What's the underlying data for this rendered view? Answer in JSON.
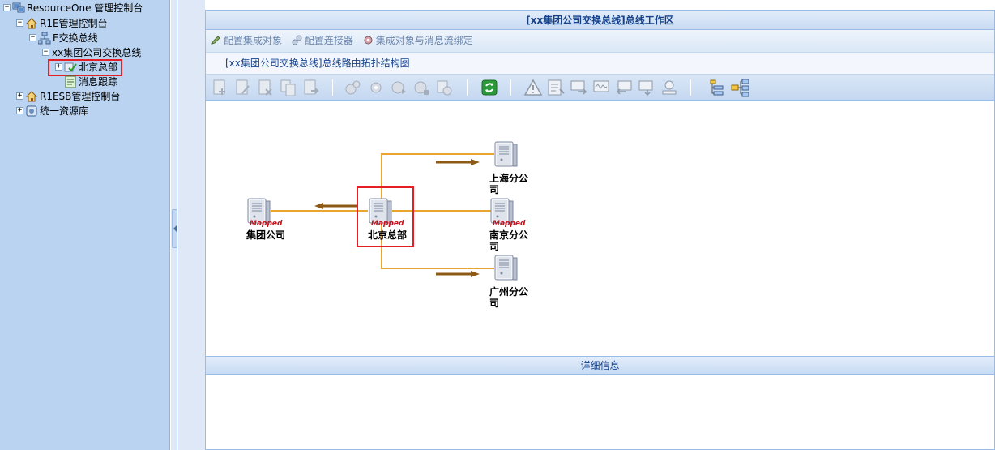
{
  "sidebar": {
    "items": [
      {
        "label": "ResourceOne 管理控制台",
        "icon": "network-computer-icon"
      },
      {
        "label": "R1E管理控制台",
        "icon": "home-icon"
      },
      {
        "label": "E交换总线",
        "icon": "bus-network-icon"
      },
      {
        "label": "xx集团公司交换总线",
        "icon": ""
      },
      {
        "label": "北京总部",
        "icon": "node-check-icon"
      },
      {
        "label": "消息跟踪",
        "icon": "document-trace-icon"
      },
      {
        "label": "R1ESB管理控制台",
        "icon": "home-icon"
      },
      {
        "label": "统一资源库",
        "icon": "database-icon"
      }
    ]
  },
  "main": {
    "title": "[xx集团公司交换总线]总线工作区",
    "actions": [
      {
        "label": "配置集成对象",
        "icon": "pencil-icon"
      },
      {
        "label": "配置连接器",
        "icon": "connector-icon"
      },
      {
        "label": "集成对象与消息流绑定",
        "icon": "gear-icon"
      }
    ],
    "subtitle": "[xx集团公司交换总线]总线路由拓扑结构图",
    "toolbar_icons": [
      "add-doc-icon",
      "edit-doc-icon",
      "delete-doc-icon",
      "copy-doc-icon",
      "export-doc-icon",
      "gears-icon",
      "gear-small-icon",
      "gear-run-icon",
      "gear-stop-icon",
      "gear-settings-icon",
      "refresh-icon",
      "warning-icon",
      "report-icon",
      "monitor-in-icon",
      "monitor-wave-icon",
      "monitor-back-icon",
      "monitor-out-icon",
      "node-config-icon",
      "tree-list-icon",
      "tree-diagram-icon"
    ],
    "detail_title": "详细信息"
  },
  "topology": {
    "nodes": [
      {
        "id": "group",
        "label": "集团公司",
        "badge": "Mapped"
      },
      {
        "id": "beijing",
        "label": "北京总部",
        "badge": "Mapped",
        "selected": true
      },
      {
        "id": "shanghai",
        "label": "上海分公司",
        "badge": ""
      },
      {
        "id": "nanjing",
        "label": "南京分公司",
        "badge": "Mapped"
      },
      {
        "id": "guangzhou",
        "label": "广州分公司",
        "badge": ""
      }
    ],
    "colors": {
      "link": "#e9a530",
      "arrow": "#8c5a14",
      "highlight": "#e31e24",
      "badge": "#c8101a"
    }
  }
}
